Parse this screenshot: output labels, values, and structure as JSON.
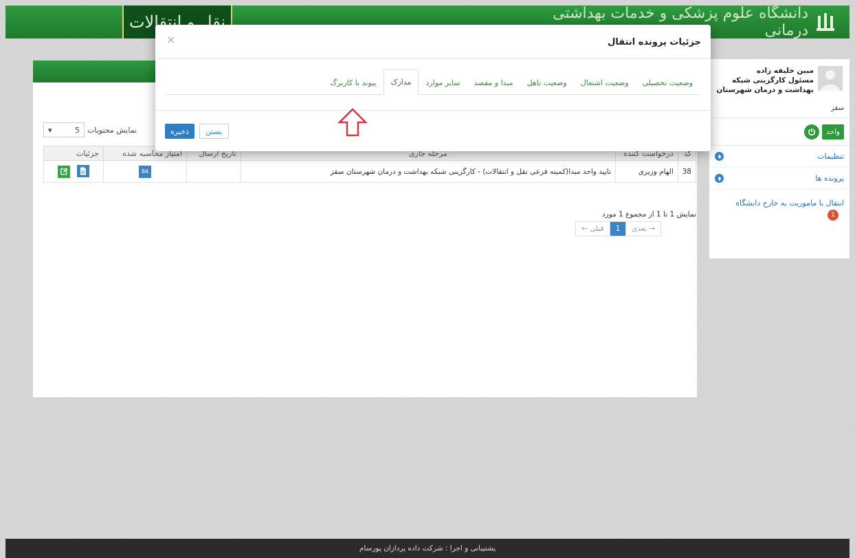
{
  "header": {
    "brand_right": "دانشگاه علوم پزشکی و خدمات بهداشتی درمانی",
    "brand_left": "نقل و انتقالات"
  },
  "sidebar": {
    "user_name": "مبین خلیفه زاده",
    "user_role": "مسئول کارگزینی شبکه بهداشت و درمان شهرستان",
    "user_city": "سقز",
    "unit_label": "واحد",
    "items": [
      {
        "label": "تنظیمات",
        "icon": "arrow-down-circle-icon"
      },
      {
        "label": "پرونده ها",
        "icon": "arrow-up-circle-icon"
      }
    ],
    "link_label": "انتقال با ماموریت به خارج دانشگاه",
    "link_badge": "1"
  },
  "list": {
    "length_label": "نمایش محتویات",
    "length_value": "5",
    "columns": [
      "کد",
      "درخواست کننده",
      "مرحله جاری",
      "تاریخ ارسال",
      "امتیاز محاسبه شده",
      "جزئیات"
    ],
    "rows": [
      {
        "code": "38",
        "requester": "الهام وزیری",
        "stage": "تایید واحد مبدا(کمیته فرعی نقل و انتقالات) - کارگزینی شبکه بهداشت و درمان شهرستان سقز",
        "sent_date": "",
        "score": "84"
      }
    ],
    "page_info": "نمایش 1 تا 1 از مجموع 1 مورد",
    "pager": {
      "prev": "← قبلی",
      "current": "1",
      "next": "بعدی →"
    }
  },
  "modal": {
    "title": "جزئیات پرونده انتقال",
    "close_symbol": "×",
    "tabs": [
      {
        "label": "وضعیت تحصیلی",
        "active": false
      },
      {
        "label": "وضعیت اشتغال",
        "active": false
      },
      {
        "label": "وضعیت تاهل",
        "active": false
      },
      {
        "label": "مبدا و مقصد",
        "active": false
      },
      {
        "label": "سایر موارد",
        "active": false
      },
      {
        "label": "مدارک",
        "active": true
      },
      {
        "label": "پیوند با کاربرگ",
        "active": false
      }
    ],
    "save_label": "ذخیره",
    "cancel_label": "بستن"
  },
  "footer": {
    "text": "پشتیبانی و اجرا : شرکت داده پردازان پورسام"
  },
  "colors": {
    "brand_green": "#2e9a3e",
    "primary_blue": "#2d7fc1",
    "annotation_red": "#d0343c"
  }
}
